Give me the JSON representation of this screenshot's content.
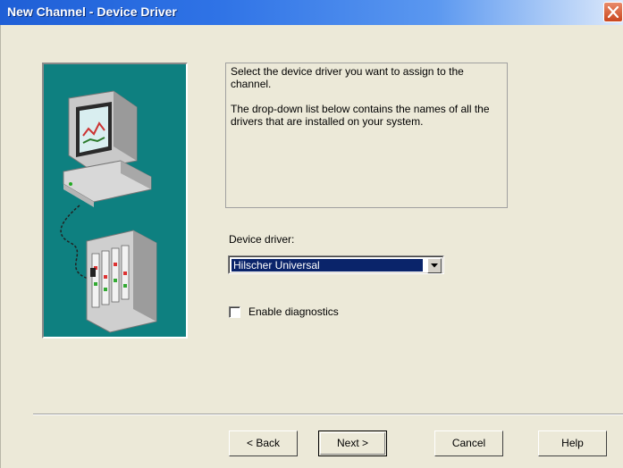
{
  "window": {
    "title": "New Channel - Device Driver"
  },
  "info": {
    "paragraph1": "Select the device driver you want to assign to the channel.",
    "paragraph2": "The drop-down list below contains the names of all the drivers that are installed on your system."
  },
  "device_driver": {
    "label": "Device driver:",
    "selected": "Hilscher Universal"
  },
  "diagnostics": {
    "label": "Enable diagnostics",
    "checked": false
  },
  "buttons": {
    "back": "< Back",
    "next": "Next >",
    "cancel": "Cancel",
    "help": "Help"
  },
  "colors": {
    "title_gradient_start": "#1f5fd6",
    "dialog_background": "#ece9d8",
    "illustration_background": "#0e8080",
    "selection_highlight": "#0a246a",
    "close_button": "#c9461f"
  },
  "icons": {
    "close": "close-icon",
    "dropdown": "chevron-down-icon",
    "illustration": "computer-and-device-illustration"
  }
}
